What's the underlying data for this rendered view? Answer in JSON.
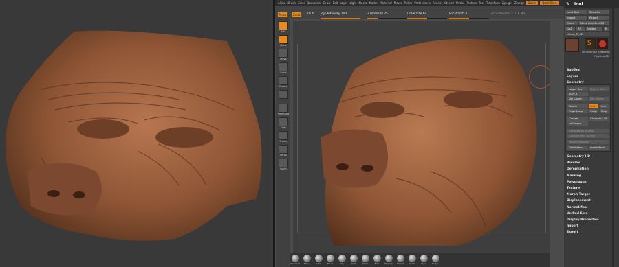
{
  "menu": [
    "Alpha",
    "Brush",
    "Color",
    "Document",
    "Draw",
    "Edit",
    "Layer",
    "Light",
    "Macro",
    "Marker",
    "Material",
    "Movie",
    "Picker",
    "Preferences",
    "Render",
    "Stencil",
    "Stroke",
    "Texture",
    "Tool",
    "Transform",
    "Zplugin",
    "Zscript"
  ],
  "menu_hot": [
    "Zoom",
    "QuickSave"
  ],
  "topbar": {
    "mrgb": "Mrgb",
    "rgb": "Rgb",
    "zadd": "Zadd",
    "zsub": "Zsub",
    "zcut": "Zcut",
    "rgb_intensity": "Rgb Intensity 100",
    "z_intensity": "Z Intensity 25",
    "draw_size": "Draw Size 64",
    "focal_shift": "Focal Shift 0",
    "active_points": "ActivePoints: 2.018 Mil"
  },
  "slider_values": {
    "rgb_intensity": 1.0,
    "z_intensity": 0.25,
    "draw_size": 0.5,
    "focal_shift": 0.5
  },
  "left_shelf": [
    {
      "label": "Edit",
      "name": "edit-button"
    },
    {
      "label": "Draw",
      "name": "draw-button"
    },
    {
      "label": "Move",
      "name": "move-button"
    },
    {
      "label": "Scale",
      "name": "scale-button"
    },
    {
      "label": "Rotate",
      "name": "rotate-button"
    },
    {
      "label": "",
      "name": "blank-button"
    },
    {
      "label": "Freehand",
      "name": "freehand-button"
    },
    {
      "label": "Dots",
      "name": "dots-button"
    },
    {
      "label": "Frame",
      "name": "frame-button"
    },
    {
      "label": "Persp",
      "name": "persp-button"
    },
    {
      "label": "Lsym",
      "name": "lsym-button"
    }
  ],
  "brushes": [
    "Standard",
    "Move",
    "Inflat",
    "Pinch",
    "Clay",
    "Polish",
    "Polish",
    "Blob",
    "Magnify",
    "Project",
    "Slash",
    "Layer",
    "Nudge"
  ],
  "tool_panel": {
    "title": "Tool",
    "load_tool": "Load Tool",
    "save_as": "Save As",
    "import": "Import",
    "export": "Export",
    "clone": "Clone",
    "make_polymesh": "Make PolyMesh3D",
    "goz": "GoZ",
    "all": "All",
    "visible": "Visible",
    "r": "R",
    "chimp_name": "chimp_C_42",
    "thumb_labels": [
      "SimpleBrush",
      "Sphere3D",
      "PolyMesh3D"
    ],
    "sections_top": [
      "SubTool",
      "Layers",
      "Geometry"
    ],
    "geometry": {
      "lower_res": "Lower Res",
      "higher_res": "Higher Res",
      "sdiv": "SDiv 6",
      "del_lower": "Del Lower",
      "del_higher": "Del Higher",
      "divide": "Divide",
      "smt": "Smt",
      "suv": "Suv",
      "edge_loop": "Edge Loop",
      "crisp": "Crisp",
      "disp": "Disp",
      "crease": "Crease",
      "crease_lvl": "CreaseLvl 15",
      "uncrease": "UnCrease",
      "reconstruct_subdiv": "Reconstruct Subdiv",
      "convert_bpr": "Convert BPR To Geo",
      "modify_topology": "Modify Topology",
      "del_hidden": "DelHidden",
      "insert_mesh": "InsertMesh"
    },
    "sections_bottom": [
      "Geometry HD",
      "Preview",
      "Deformation",
      "Masking",
      "Polygroups",
      "Texture",
      "Morph Target",
      "Displacement",
      "NormalMap",
      "Unified Skin",
      "Display Properties",
      "Import",
      "Export"
    ]
  },
  "colors": {
    "accent": "#e58a1f",
    "skin": "#9b5f3c",
    "brush_ring": "#b84a35"
  }
}
